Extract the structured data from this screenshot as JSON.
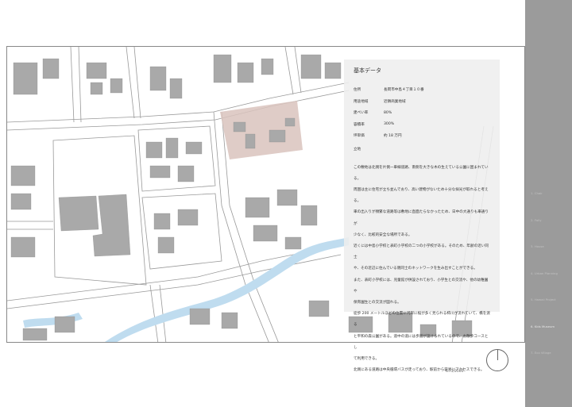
{
  "panel": {
    "title": "基本データ",
    "rows": [
      {
        "key": "住所",
        "value": "長岡市中島４丁目１０番"
      },
      {
        "key": "用途地域",
        "value": "近隣商業地域"
      },
      {
        "key": "建ぺい率",
        "value": "80%"
      },
      {
        "key": "容積率",
        "value": "300%"
      },
      {
        "key": "坪単価",
        "value": "約 18 万円"
      }
    ],
    "section": "立地",
    "paragraphs": [
      "この敷地は北側を片側一車線道路、南側を大きな木の生えている公園に囲まれている。",
      "周囲は主に住宅が立ち並んでおり、高い建物がないため十分な採光が取れると考える。",
      "車の出入りが頻繁な道路等は敷地に直面たらなかったため、日中の大通りも車通りが",
      "少なく、比較的安全な場所である。",
      "近くには中島小学校と表町小学校の二つの小学校がある。そのため、年齢の近い同士",
      "や、その近辺に住んでいる親同士のネットワークを生み出すことができる。",
      "また、表町小学校には、児童館が併設されており、小学生との交流や、他の幼稚園や",
      "保育園生との交流が図れる。",
      "徒歩 200 メートルほどの位置に河岸に桜が多く見られる柿川が流れていて、橋を渡る",
      "と平和の森公園がある。道中の道には歩道が設けられているので、お散歩コースとし",
      "て利用できる。",
      "北側にある道路は中央循環バスが走っており、駅前から容易にアクセスできる。"
    ]
  },
  "scale": "S=1/2000",
  "sidebar": {
    "items": [
      {
        "label": "1.  Chair"
      },
      {
        "label": "2.  Folly"
      },
      {
        "label": "3.  House"
      },
      {
        "label": "4.  Urban Planning"
      },
      {
        "label": "5.  Hawaii Project"
      },
      {
        "label": "6.  Kids Museum"
      },
      {
        "label": "7.  Eco Village"
      }
    ],
    "active_index": 5
  },
  "colors": {
    "site": "#d9c3bd",
    "river": "#bfdcef",
    "building": "#a9a9a9",
    "sidebar": "#9b9b9b"
  }
}
